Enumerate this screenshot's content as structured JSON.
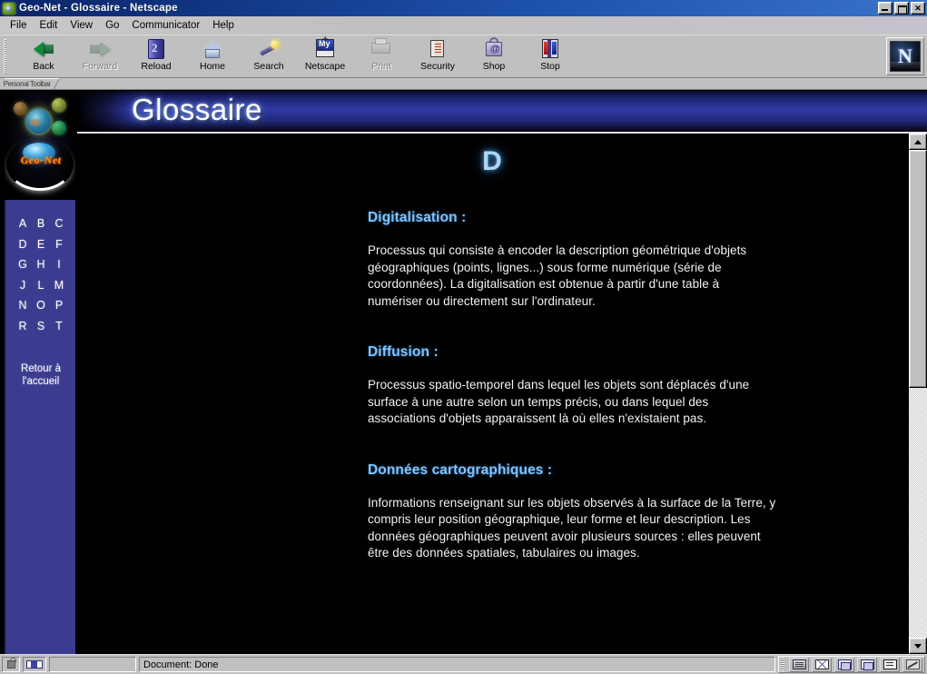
{
  "window": {
    "title": "Geo-Net - Glossaire - Netscape",
    "icon": "geonet-app-icon",
    "buttons": {
      "minimize": "minimize-button",
      "restore": "restore-button",
      "close": "✕"
    }
  },
  "menubar": {
    "items": [
      {
        "label": "File",
        "accel": "F"
      },
      {
        "label": "Edit",
        "accel": "E"
      },
      {
        "label": "View",
        "accel": "V"
      },
      {
        "label": "Go",
        "accel": "G"
      },
      {
        "label": "Communicator",
        "accel": "C"
      },
      {
        "label": "Help",
        "accel": "H"
      }
    ]
  },
  "toolbar": {
    "buttons": [
      {
        "label": "Back",
        "icon": "back-arrow-icon",
        "disabled": false
      },
      {
        "label": "Forward",
        "icon": "forward-arrow-icon",
        "disabled": true
      },
      {
        "label": "Reload",
        "icon": "reload-icon",
        "disabled": false
      },
      {
        "label": "Home",
        "icon": "home-icon",
        "disabled": false
      },
      {
        "label": "Search",
        "icon": "search-icon",
        "disabled": false
      },
      {
        "label": "Netscape",
        "icon": "netscape-my-icon",
        "disabled": false
      },
      {
        "label": "Print",
        "icon": "print-icon",
        "disabled": true
      },
      {
        "label": "Security",
        "icon": "security-lock-icon",
        "disabled": false
      },
      {
        "label": "Shop",
        "icon": "shop-bag-icon",
        "disabled": false
      },
      {
        "label": "Stop",
        "icon": "stop-icon",
        "disabled": false
      }
    ],
    "brand_logo": "N"
  },
  "personal_toolbar": {
    "tab_label": "Personal Toolbar"
  },
  "page": {
    "site_logo": {
      "wordmark": "Geo-Net",
      "alt": "geo-net-logo"
    },
    "banner_title": "Glossaire",
    "letter_heading": "D",
    "sidebar": {
      "letters": [
        "A",
        "B",
        "C",
        "D",
        "E",
        "F",
        "G",
        "H",
        "I",
        "J",
        "L",
        "M",
        "N",
        "O",
        "P",
        "R",
        "S",
        "T"
      ],
      "home_link": "Retour à l'accueil"
    },
    "entries": [
      {
        "term": "Digitalisation :",
        "definition": "Processus qui consiste à encoder la description géométrique d'objets géographiques (points, lignes...) sous forme numérique (série de coordonnées). La digitalisation est obtenue à partir d'une table à numériser ou directement sur l'ordinateur."
      },
      {
        "term": "Diffusion :",
        "definition": "Processus spatio-temporel dans lequel les objets sont déplacés d'une surface à une autre selon un temps précis, ou dans lequel des associations d'objets apparaissent là où elles n'existaient pas."
      },
      {
        "term": "Données cartographiques :",
        "definition": "Informations renseignant sur les objets observés à la surface de la Terre, y compris leur position géographique, leur forme et leur description. Les données géographiques peuvent avoir plusieurs sources : elles peuvent être des données spatiales, tabulaires ou images."
      }
    ]
  },
  "scrollbar": {
    "up_arrow": "scroll-up-arrow",
    "down_arrow": "scroll-down-arrow"
  },
  "statusbar": {
    "message": "Document: Done",
    "security_icon": "padlock-icon",
    "connection_icon": "connection-icon",
    "component_bar": [
      {
        "name": "navigator",
        "icon": "navigator-icon"
      },
      {
        "name": "mailbox",
        "icon": "mailbox-icon"
      },
      {
        "name": "newsgroups",
        "icon": "newsgroups-icon"
      },
      {
        "name": "address-book",
        "icon": "address-book-icon"
      },
      {
        "name": "composer",
        "icon": "composer-icon"
      }
    ]
  },
  "colors": {
    "chrome": "#c0c0c0",
    "titlebar": "#0a246a",
    "sidebar": "#3b3b8f",
    "page_bg": "#000000",
    "term_accent": "#7fc4ff",
    "letter_accent": "#a8d8f8",
    "logo_text": "#ff8c1a"
  }
}
